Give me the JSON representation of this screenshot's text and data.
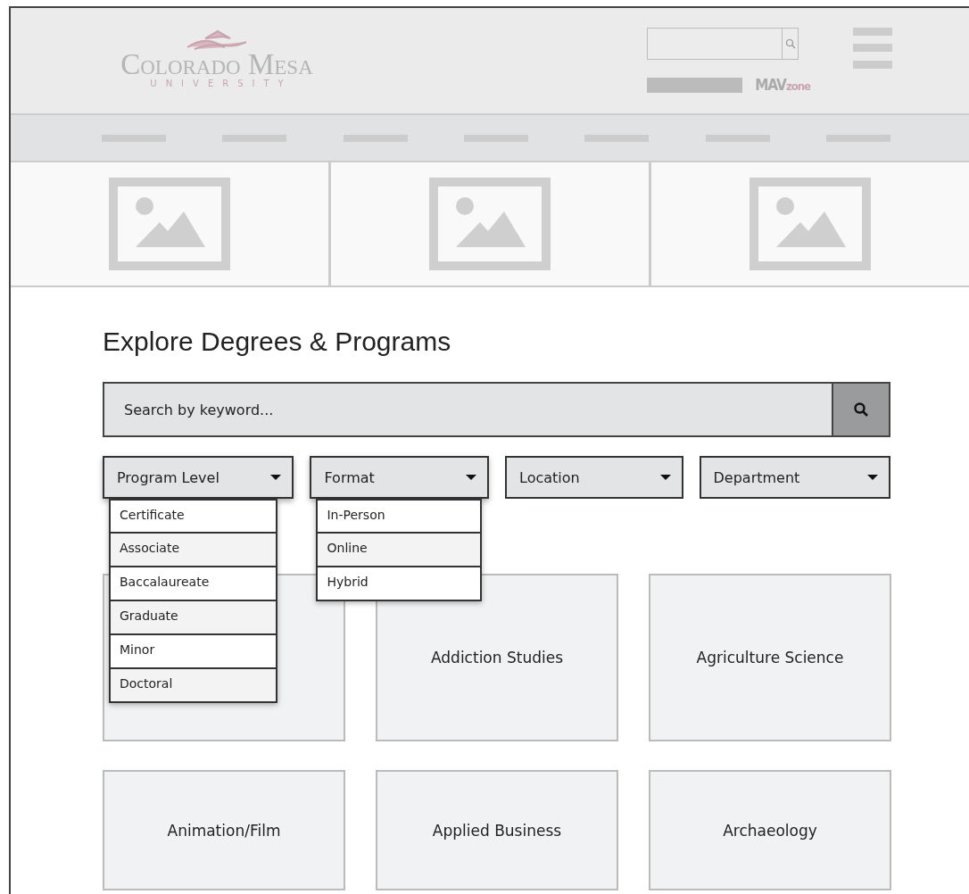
{
  "header": {
    "logo": {
      "name": "Colorado Mesa",
      "subtitle": "UNIVERSITY"
    },
    "brand": {
      "part_1": "MAV",
      "part_2": "zone"
    }
  },
  "heading": "Explore Degrees & Programs",
  "search": {
    "placeholder": "Search by keyword..."
  },
  "filters": [
    {
      "label": "Program Level",
      "expanded": true,
      "options": [
        "Certificate",
        "Associate",
        "Baccalaureate",
        "Graduate",
        "Minor",
        "Doctoral"
      ]
    },
    {
      "label": "Format",
      "expanded": true,
      "options": [
        "In-Person",
        "Online",
        "Hybrid"
      ]
    },
    {
      "label": "Location",
      "expanded": false
    },
    {
      "label": "Department",
      "expanded": false
    }
  ],
  "cards": [
    {
      "kind": "hidden"
    },
    {
      "kind": "program",
      "title": "Addiction Studies"
    },
    {
      "kind": "program",
      "title": "Agriculture Science"
    },
    {
      "kind": "program",
      "title": "Animation/Film"
    },
    {
      "kind": "program",
      "title": "Applied Business"
    },
    {
      "kind": "program",
      "title": "Archaeology"
    }
  ]
}
